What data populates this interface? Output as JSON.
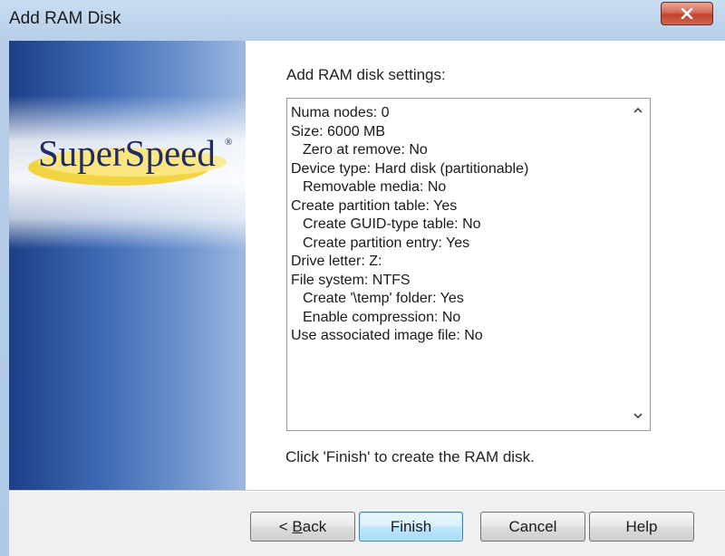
{
  "window": {
    "title": "Add RAM Disk"
  },
  "branding": {
    "logo_text": "SuperSpeed",
    "logo_mark": "®"
  },
  "main": {
    "heading": "Add RAM disk settings:",
    "settings": [
      {
        "text": "Numa nodes: 0",
        "indent": false
      },
      {
        "text": "Size: 6000 MB",
        "indent": false
      },
      {
        "text": "Zero at remove: No",
        "indent": true
      },
      {
        "text": "Device type: Hard disk (partitionable)",
        "indent": false
      },
      {
        "text": "Removable media: No",
        "indent": true
      },
      {
        "text": "Create partition table: Yes",
        "indent": false
      },
      {
        "text": "Create GUID-type table: No",
        "indent": true
      },
      {
        "text": "Create partition entry: Yes",
        "indent": true
      },
      {
        "text": "Drive letter: Z:",
        "indent": false
      },
      {
        "text": "File system: NTFS",
        "indent": false
      },
      {
        "text": "Create '\\temp' folder: Yes",
        "indent": true
      },
      {
        "text": "Enable compression: No",
        "indent": true
      },
      {
        "text": "Use associated image file: No",
        "indent": false
      }
    ],
    "footer": "Click 'Finish' to create the RAM disk."
  },
  "buttons": {
    "back_prefix": "< ",
    "back_mnemonic": "B",
    "back_rest": "ack",
    "finish": "Finish",
    "cancel": "Cancel",
    "help": "Help"
  },
  "icons": {
    "close": "close-icon",
    "scroll_up": "scroll-up-arrow-icon",
    "scroll_down": "scroll-down-arrow-icon"
  },
  "colors": {
    "close_button": "#c8462f",
    "banner_dark": "#1c3f86",
    "default_button": "#a7d9f5"
  }
}
